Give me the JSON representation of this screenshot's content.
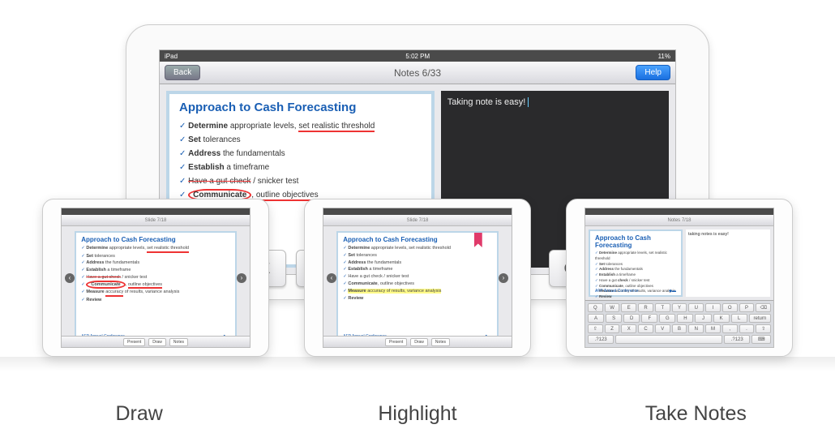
{
  "status": {
    "device": "iPad",
    "time": "5:02 PM",
    "battery": "11%"
  },
  "topbar": {
    "back": "Back",
    "title": "Notes 6/33",
    "help": "Help"
  },
  "slide": {
    "title": "Approach to Cash Forecasting",
    "items": [
      {
        "lead": "Determine",
        "rest": " appropriate levels, ",
        "tail": "set realistic threshold"
      },
      {
        "lead": "Set",
        "rest": " tolerances"
      },
      {
        "lead": "Address",
        "rest": " the fundamentals"
      },
      {
        "lead": "Establish",
        "rest": " a timeframe"
      },
      {
        "strike": "Have a gut check",
        "rest": " / snicker test"
      },
      {
        "circle": "Communicate",
        "rest": ", ",
        "tail": "outline objectives"
      },
      {
        "lead": "Measure",
        "rest": " accuracy of results, variance analysis"
      },
      {
        "lead": "Review",
        "rest": ""
      }
    ],
    "footer_left": "AFP Annual Conference"
  },
  "notes_area": {
    "text": "Taking note is easy!"
  },
  "keyboard_peek": [
    "E",
    "R",
    "O",
    "P"
  ],
  "mini_top": "Slide  7/18",
  "mini_notes_top": "Notes 7/18",
  "mini_buttons": [
    "Present",
    "Draw",
    "Notes"
  ],
  "mini_notes_text": "taking notes is easy!",
  "mini_kb": {
    "r1": [
      "Q",
      "W",
      "E",
      "R",
      "T",
      "Y",
      "U",
      "I",
      "O",
      "P",
      "⌫"
    ],
    "r2": [
      "A",
      "S",
      "D",
      "F",
      "G",
      "H",
      "J",
      "K",
      "L",
      "return"
    ],
    "r3": [
      "⇧",
      "Z",
      "X",
      "C",
      "V",
      "B",
      "N",
      "M",
      ",",
      ".",
      "⇧"
    ],
    "r4": [
      ".?123",
      "",
      "",
      ".?123",
      "⌨"
    ]
  },
  "captions": {
    "draw": "Draw",
    "highlight": "Highlight",
    "notes": "Take Notes"
  }
}
